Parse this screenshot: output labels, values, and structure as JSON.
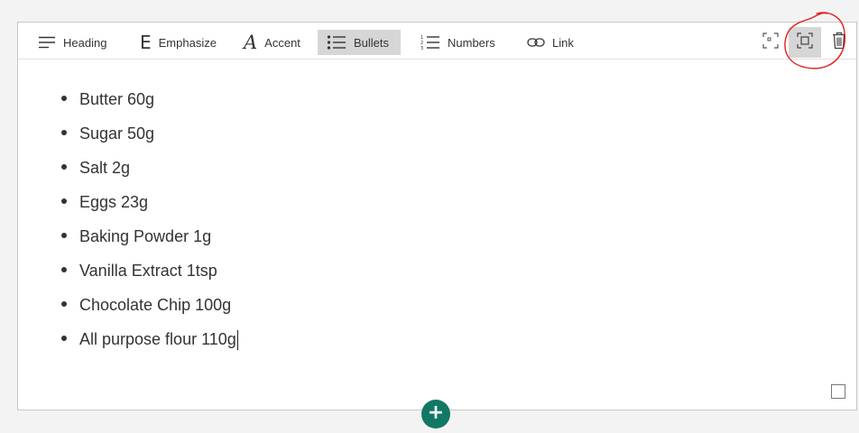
{
  "toolbar": {
    "heading": {
      "label": "Heading",
      "icon": "heading-icon"
    },
    "emphasize": {
      "label": "Emphasize",
      "icon": "E"
    },
    "accent": {
      "label": "Accent",
      "icon": "A"
    },
    "bullets": {
      "label": "Bullets",
      "icon": "bullets-icon",
      "active": true
    },
    "numbers": {
      "label": "Numbers",
      "icon": "numbered-list-icon"
    },
    "link": {
      "label": "Link",
      "icon": "link-icon"
    },
    "right_buttons": [
      {
        "name": "expand-icon",
        "active": false
      },
      {
        "name": "focus-mode-icon",
        "active": true
      },
      {
        "name": "trash-icon",
        "active": false
      }
    ]
  },
  "content": {
    "items": [
      "Butter 60g",
      "Sugar 50g",
      "Salt 2g",
      "Eggs 23g",
      "Baking Powder 1g",
      "Vanilla Extract 1tsp",
      "Chocolate Chip 100g",
      "All purpose flour 110g"
    ]
  },
  "add_button": {
    "symbol": "+"
  },
  "colors": {
    "accent": "#117865",
    "active_bg": "#d6d6d6",
    "annotation": "#e02020"
  }
}
